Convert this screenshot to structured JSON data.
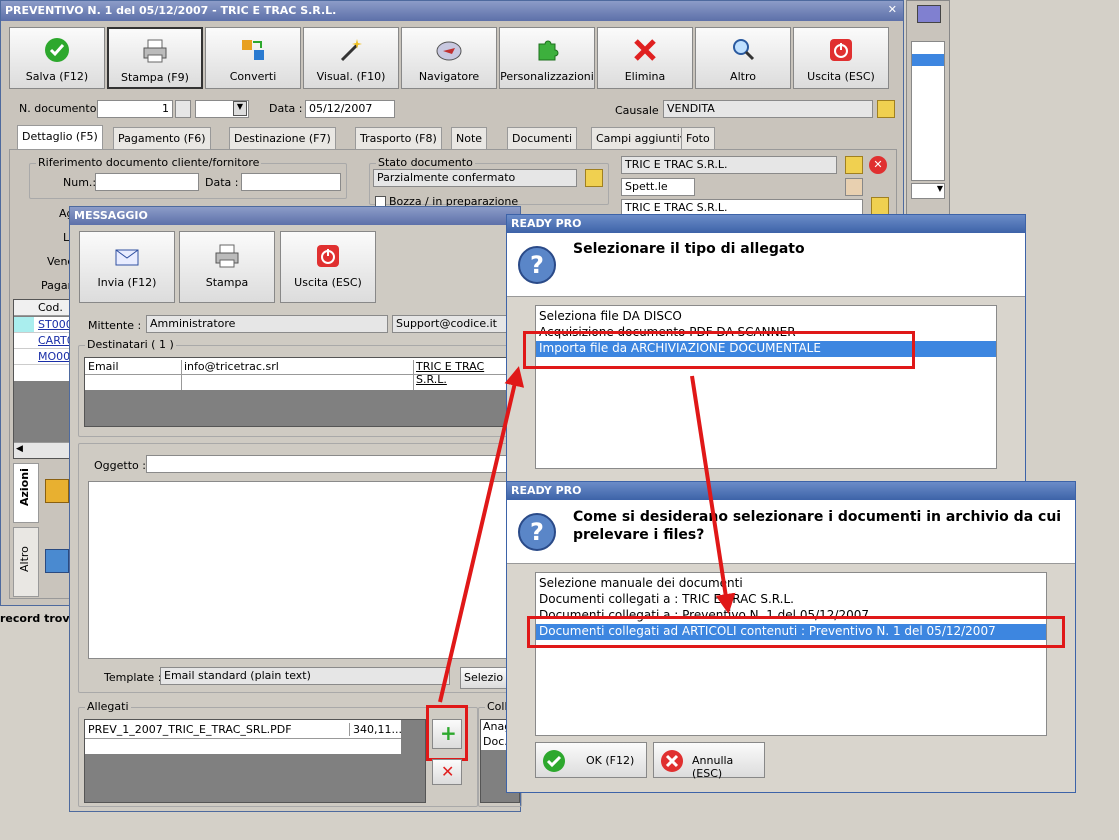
{
  "main": {
    "title": "PREVENTIVO N. 1 del 05/12/2007 - TRIC E TRAC S.R.L.",
    "toolbar": [
      "Salva (F12)",
      "Stampa (F9)",
      "Converti",
      "Visual. (F10)",
      "Navigatore",
      "Personalizzazioni",
      "Elimina",
      "Altro",
      "Uscita (ESC)"
    ],
    "ndoc_label": "N. documento :",
    "ndoc_value": "1",
    "data_label": "Data :",
    "data_value": "05/12/2007",
    "causale_label": "Causale :",
    "causale_value": "VENDITA",
    "tabs": [
      "Dettaglio (F5)",
      "Pagamento (F6)",
      "Destinazione (F7)",
      "Trasporto (F8)",
      "Note",
      "Documenti",
      "Campi aggiuntivi",
      "Foto"
    ],
    "rif_title": "Riferimento documento cliente/fornitore",
    "num_label": "Num.:",
    "data2_label": "Data :",
    "stato_title": "Stato documento",
    "stato_value": "Parzialmente confermato",
    "bozza_label": "Bozza / in preparazione",
    "cliente": "TRIC E TRAC S.R.L.",
    "spett": "Spett.le",
    "cliente2": "TRIC E TRAC S.R.L.",
    "side_labels": [
      "Ag",
      "Li",
      "Vend",
      "Pagan"
    ],
    "cod_header": "Cod.",
    "cod_rows": [
      "ST000",
      "CART0",
      "MO001"
    ],
    "vtab_azioni": "Azioni",
    "vtab_altro": "Altro",
    "status": "record trova"
  },
  "msg": {
    "title": "MESSAGGIO",
    "toolbar": [
      "Invia (F12)",
      "Stampa",
      "Uscita (ESC)"
    ],
    "mittente_label": "Mittente :",
    "mittente_value": "Amministratore",
    "mittente_email": "Support@codice.it",
    "dest_title": "Destinatari ( 1 )",
    "dest_type": "Email",
    "dest_email": "info@tricetrac.srl",
    "dest_name": "TRIC E TRAC S.R.L.",
    "oggetto_label": "Oggetto :",
    "template_label": "Template :",
    "template_value": "Email standard (plain text)",
    "selez_label": "Selezio",
    "allegati_title": "Allegati",
    "allegato_file": "PREV_1_2007_TRIC_E_TRAC_SRL.PDF",
    "allegato_size": "340,11...",
    "colleg_title": "Colleg",
    "colleg_rows": [
      "Anag",
      "Doc.i"
    ]
  },
  "dlg1": {
    "title": "READY PRO",
    "question": "Selezionare il tipo di allegato",
    "options": [
      "Seleziona file DA DISCO",
      "Acquisizione documento PDF DA SCANNER",
      "Importa file da ARCHIVIAZIONE DOCUMENTALE"
    ]
  },
  "dlg2": {
    "title": "READY PRO",
    "question_line1": "Come si desiderano selezionare i documenti in archivio da cui",
    "question_line2": "prelevare i files?",
    "options": [
      "Selezione manuale dei documenti",
      "Documenti collegati a : TRIC E TRAC S.R.L.",
      "Documenti collegati a : Preventivo N. 1 del 05/12/2007",
      "Documenti collegati ad ARTICOLI contenuti : Preventivo N. 1 del 05/12/2007"
    ],
    "ok_label": "OK (F12)",
    "cancel_label": "Annulla (ESC)"
  },
  "colors": {
    "highlight": "#e01818",
    "selection": "#3d86e0",
    "title_blue": "#3d63a8"
  }
}
